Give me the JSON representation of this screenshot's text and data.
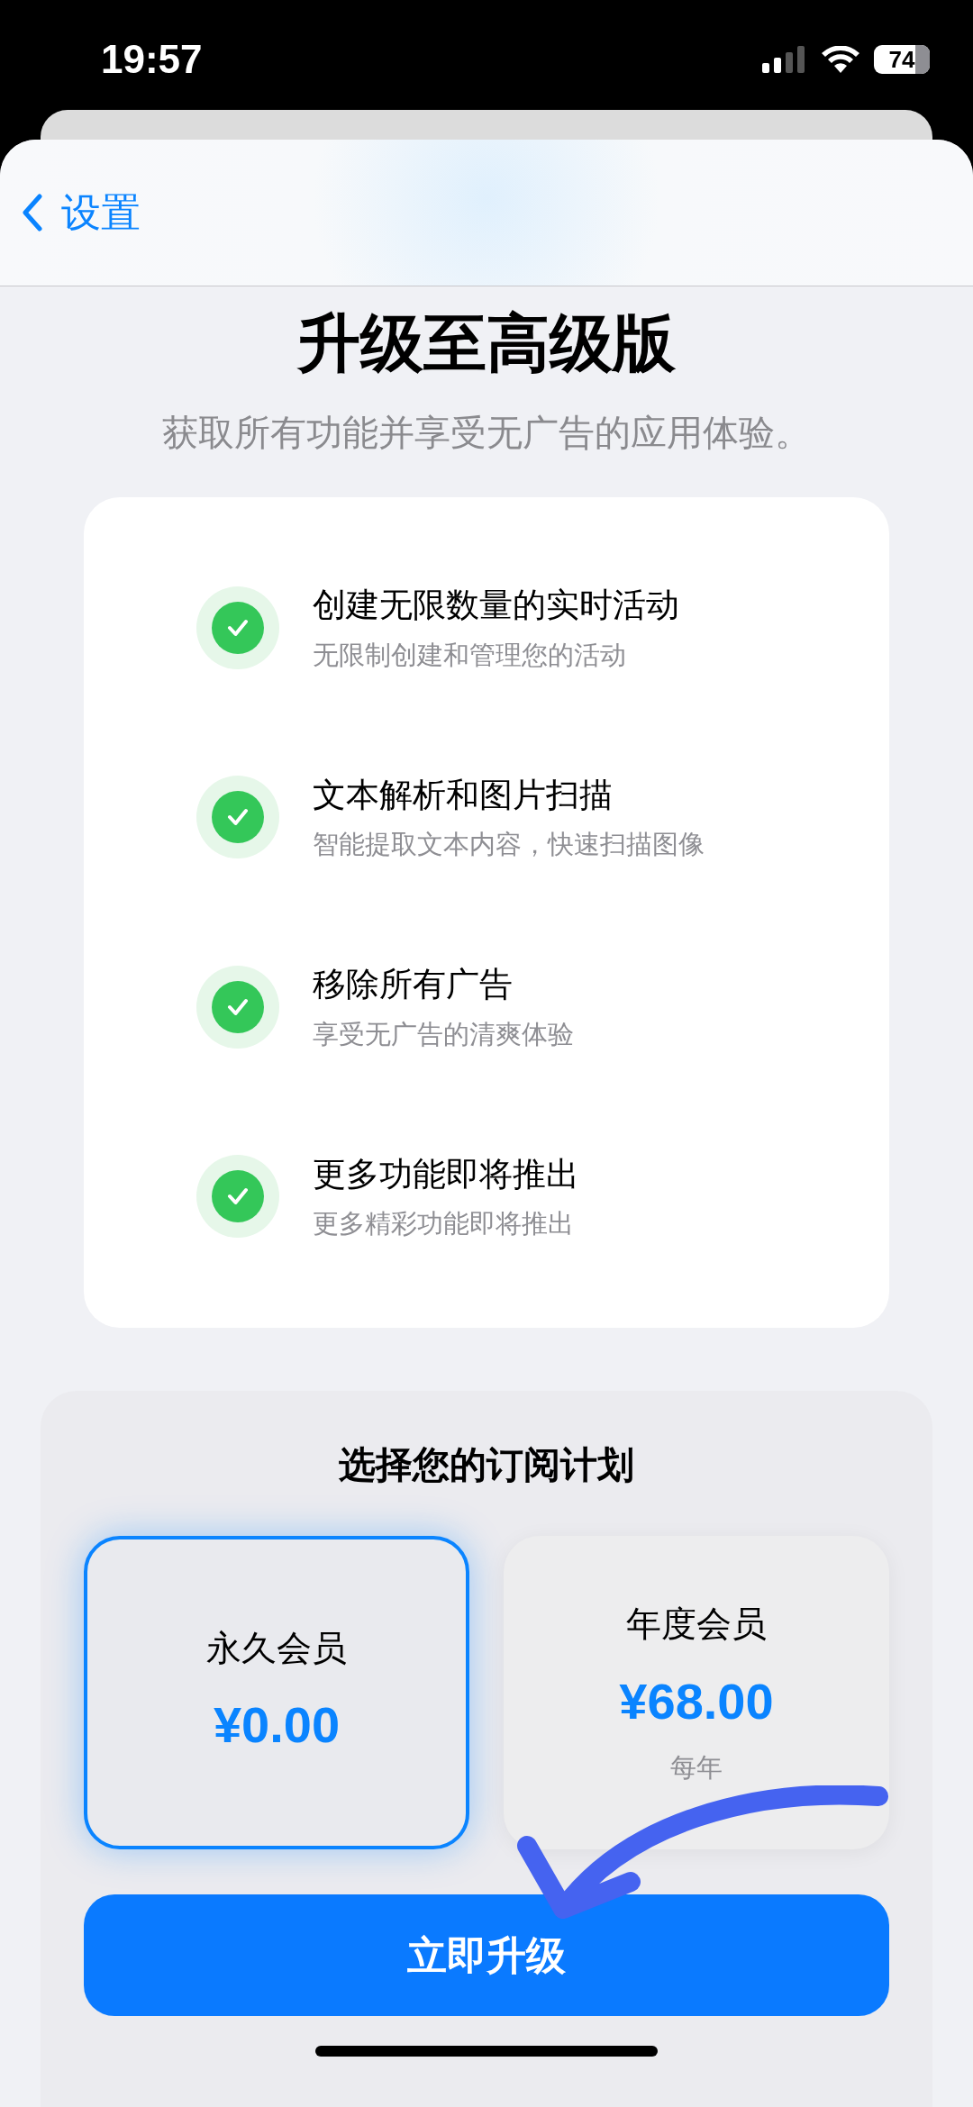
{
  "status_bar": {
    "time": "19:57",
    "battery": "74"
  },
  "nav": {
    "back_label": "设置"
  },
  "title": "升级至高级版",
  "subtitle": "获取所有功能并享受无广告的应用体验。",
  "features": [
    {
      "title": "创建无限数量的实时活动",
      "description": "无限制创建和管理您的活动",
      "checked": true
    },
    {
      "title": "文本解析和图片扫描",
      "description": "智能提取文本内容，快速扫描图像",
      "checked": true
    },
    {
      "title": "移除所有广告",
      "description": "享受无广告的清爽体验",
      "checked": true
    },
    {
      "title": "更多功能即将推出",
      "description": "更多精彩功能即将推出",
      "checked": true
    }
  ],
  "plans": {
    "heading": "选择您的订阅计划",
    "items": [
      {
        "name": "永久会员",
        "price": "¥0.00",
        "selected": true
      },
      {
        "name": "年度会员",
        "price": "¥68.00",
        "period": "每年",
        "selected": false
      }
    ]
  },
  "upgrade_button": "立即升级"
}
